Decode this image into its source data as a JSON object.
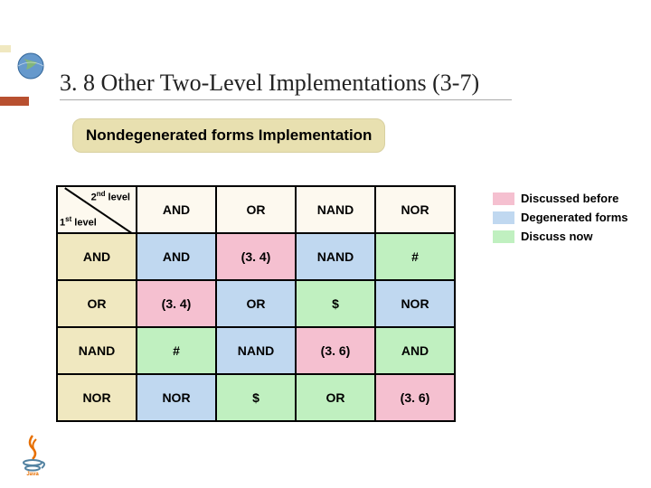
{
  "title": "3. 8 Other Two-Level Implementations (3-7)",
  "section_banner": "Nondegenerated forms Implementation",
  "corner": {
    "second": "2",
    "second_suffix": " level",
    "first": "1",
    "first_suffix": " level",
    "nd": "nd",
    "st": "st"
  },
  "col_headers": [
    "AND",
    "OR",
    "NAND",
    "NOR"
  ],
  "row_headers": [
    "AND",
    "OR",
    "NAND",
    "NOR"
  ],
  "cells": [
    [
      "AND",
      "(3. 4)",
      "NAND",
      "#"
    ],
    [
      "(3. 4)",
      "OR",
      "$",
      "NOR"
    ],
    [
      "#",
      "NAND",
      "(3. 6)",
      "AND"
    ],
    [
      "NOR",
      "$",
      "OR",
      "(3. 6)"
    ]
  ],
  "cell_colors": [
    [
      "c-blue",
      "c-pink",
      "c-blue",
      "c-green"
    ],
    [
      "c-pink",
      "c-blue",
      "c-green",
      "c-blue"
    ],
    [
      "c-green",
      "c-blue",
      "c-pink",
      "c-green"
    ],
    [
      "c-blue",
      "c-green",
      "c-green",
      "c-pink"
    ]
  ],
  "legend": [
    {
      "color": "lg-pink",
      "label": "Discussed before"
    },
    {
      "color": "lg-blue",
      "label": "Degenerated forms"
    },
    {
      "color": "lg-green",
      "label": "Discuss now"
    }
  ]
}
